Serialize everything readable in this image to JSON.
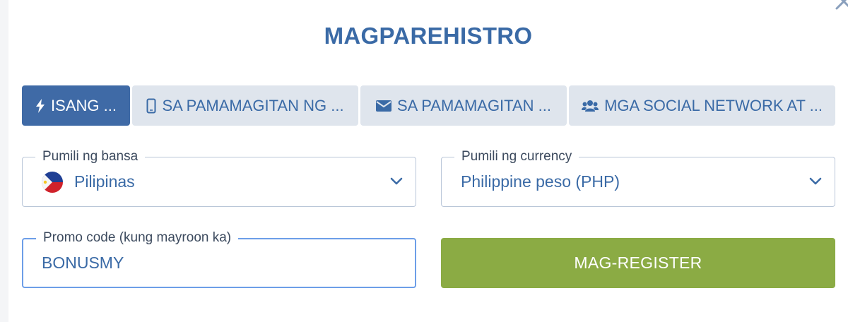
{
  "header": {
    "title": "MAGPAREHISTRO",
    "close_icon": "close-icon"
  },
  "tabs": [
    {
      "label": "ISANG ...",
      "icon": "lightning-icon",
      "active": true
    },
    {
      "label": "SA PAMAMAGITAN NG ...",
      "icon": "phone-icon",
      "active": false
    },
    {
      "label": "SA PAMAMAGITAN ...",
      "icon": "envelope-icon",
      "active": false
    },
    {
      "label": "MGA SOCIAL NETWORK AT ...",
      "icon": "users-icon",
      "active": false
    }
  ],
  "form": {
    "country": {
      "label": "Pumili ng bansa",
      "value": "Pilipinas",
      "flag_icon": "philippines-flag-icon"
    },
    "currency": {
      "label": "Pumili ng currency",
      "value": "Philippine peso (PHP)"
    },
    "promo": {
      "label": "Promo code (kung mayroon ka)",
      "value": "BONUSMY"
    },
    "register_label": "MAG-REGISTER"
  },
  "colors": {
    "accent_blue": "#3a6aa6",
    "tab_inactive_bg": "#dfe5ed",
    "register_green": "#8bab44",
    "focus_border": "#6d9ee8"
  }
}
